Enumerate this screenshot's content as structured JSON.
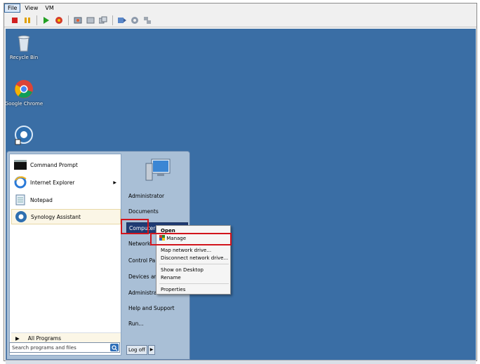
{
  "menubar": {
    "items": [
      "File",
      "View",
      "VM"
    ],
    "active_index": 0
  },
  "toolbar": {
    "buttons": [
      "stop-icon",
      "pause-icon",
      "play-icon",
      "reset-icon",
      "snapshot-icon",
      "revert-snapshot-icon",
      "manage-snapshots-icon",
      "send-keys-icon",
      "settings-icon",
      "network-icon"
    ]
  },
  "desktop": {
    "background": "#3a6ea5",
    "icons": [
      {
        "label": "Recycle Bin",
        "icon": "recycle-bin-icon"
      },
      {
        "label": "Google Chrome",
        "icon": "chrome-icon"
      },
      {
        "label": "",
        "icon": "synology-assistant-shortcut-icon"
      }
    ]
  },
  "start_menu": {
    "programs": [
      {
        "label": "Command Prompt",
        "icon": "command-prompt-icon",
        "has_submenu": false
      },
      {
        "label": "Internet Explorer",
        "icon": "internet-explorer-icon",
        "has_submenu": true
      },
      {
        "label": "Notepad",
        "icon": "notepad-icon",
        "has_submenu": false
      },
      {
        "label": "Synology Assistant",
        "icon": "synology-assistant-icon",
        "has_submenu": false,
        "highlighted": true
      }
    ],
    "all_programs": "All Programs",
    "search_placeholder": "Search programs and files",
    "right_items": [
      "Administrator",
      "Documents",
      "Computer",
      "Network",
      "Control Pa",
      "Devices ar",
      "Administra",
      "Help and Support",
      "Run..."
    ],
    "selected_right_item": "Computer",
    "logoff_label": "Log off"
  },
  "context_menu": {
    "items": [
      {
        "label": "Open",
        "bold": true
      },
      {
        "label": "Manage",
        "icon": "manage-shield-icon",
        "highlighted": true
      },
      {
        "label": "Map network drive...",
        "separator_before": true
      },
      {
        "label": "Disconnect network drive..."
      },
      {
        "label": "Show on Desktop",
        "separator_before": true
      },
      {
        "label": "Rename"
      },
      {
        "label": "Properties",
        "separator_before": true
      }
    ]
  },
  "colors": {
    "highlight_red": "#d2141c",
    "selection_navy": "#1f3b73"
  }
}
